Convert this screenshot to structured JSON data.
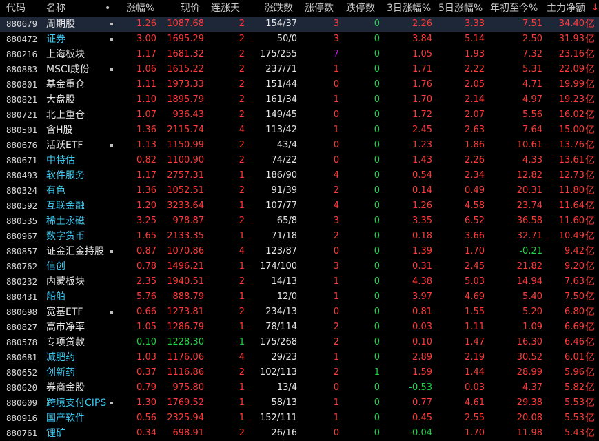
{
  "colors": {
    "up": "#ff3a3a",
    "down": "#22d24a",
    "neutral": "#e6e6e6",
    "highlight_name": "#3cc8f0",
    "limit_up_special": "#c020e0",
    "selected_row": "#1e2738",
    "background": "#000000"
  },
  "icons": {
    "sort": "sort-descending-arrow-icon",
    "marker": "dot-marker-icon"
  },
  "header": {
    "code": "代码",
    "name": "名称",
    "marker": "•",
    "change_pct": "涨幅%",
    "price": "现价",
    "streak": "连涨天",
    "up_down": "涨跌数",
    "limit_up": "涨停数",
    "limit_down": "跌停数",
    "d3_pct": "3日涨幅%",
    "d5_pct": "5日涨幅%",
    "ytd_pct": "年初至今%",
    "main_net": "主力净额",
    "sort_arrow": "↓"
  },
  "unit": "亿",
  "rows": [
    {
      "code": "880679",
      "name": "周期股",
      "name_color": "white",
      "dot": true,
      "chg": "1.26",
      "price": "1087.68",
      "streak": "2",
      "updown": "154/37",
      "lu": "3",
      "lu_color": "red",
      "ld": "0",
      "d3": "2.26",
      "d5": "3.33",
      "ytd": "7.51",
      "ytd_color": "red",
      "net": "34.40",
      "selected": true
    },
    {
      "code": "880472",
      "name": "证券",
      "name_color": "cyan",
      "dot": true,
      "chg": "3.00",
      "price": "1695.29",
      "streak": "2",
      "updown": "50/0",
      "lu": "3",
      "lu_color": "red",
      "ld": "0",
      "d3": "3.84",
      "d5": "5.14",
      "ytd": "2.50",
      "ytd_color": "red",
      "net": "31.93"
    },
    {
      "code": "880216",
      "name": "上海板块",
      "name_color": "white",
      "dot": false,
      "chg": "1.17",
      "price": "1681.32",
      "streak": "2",
      "updown": "175/255",
      "lu": "7",
      "lu_color": "purple",
      "ld": "0",
      "d3": "1.05",
      "d5": "1.93",
      "ytd": "7.32",
      "ytd_color": "red",
      "net": "23.16"
    },
    {
      "code": "880883",
      "name": "MSCI成份",
      "name_color": "white",
      "dot": true,
      "chg": "1.06",
      "price": "1615.22",
      "streak": "2",
      "updown": "237/71",
      "lu": "1",
      "lu_color": "red",
      "ld": "0",
      "d3": "1.71",
      "d5": "2.22",
      "ytd": "5.31",
      "ytd_color": "red",
      "net": "22.09"
    },
    {
      "code": "880801",
      "name": "基金重仓",
      "name_color": "white",
      "dot": false,
      "chg": "1.11",
      "price": "1973.33",
      "streak": "2",
      "updown": "151/44",
      "lu": "0",
      "lu_color": "red",
      "ld": "0",
      "d3": "1.76",
      "d5": "2.05",
      "ytd": "4.71",
      "ytd_color": "red",
      "net": "19.99"
    },
    {
      "code": "880821",
      "name": "大盘股",
      "name_color": "white",
      "dot": false,
      "chg": "1.10",
      "price": "1895.79",
      "streak": "2",
      "updown": "161/34",
      "lu": "1",
      "lu_color": "red",
      "ld": "0",
      "d3": "1.70",
      "d5": "2.14",
      "ytd": "4.97",
      "ytd_color": "red",
      "net": "19.23"
    },
    {
      "code": "880721",
      "name": "北上重仓",
      "name_color": "white",
      "dot": false,
      "chg": "1.07",
      "price": "936.43",
      "streak": "2",
      "updown": "149/45",
      "lu": "0",
      "lu_color": "red",
      "ld": "0",
      "d3": "1.72",
      "d5": "2.07",
      "ytd": "5.56",
      "ytd_color": "red",
      "net": "16.02"
    },
    {
      "code": "880501",
      "name": "含H股",
      "name_color": "white",
      "dot": false,
      "chg": "1.36",
      "price": "2115.74",
      "streak": "4",
      "updown": "113/42",
      "lu": "1",
      "lu_color": "red",
      "ld": "0",
      "d3": "2.45",
      "d5": "2.63",
      "ytd": "7.64",
      "ytd_color": "red",
      "net": "15.00"
    },
    {
      "code": "880676",
      "name": "活跃ETF",
      "name_color": "white",
      "dot": true,
      "chg": "1.13",
      "price": "1150.99",
      "streak": "2",
      "updown": "43/4",
      "lu": "0",
      "lu_color": "red",
      "ld": "0",
      "d3": "1.23",
      "d5": "1.86",
      "ytd": "10.61",
      "ytd_color": "red",
      "net": "13.76"
    },
    {
      "code": "880671",
      "name": "中特估",
      "name_color": "cyan",
      "dot": false,
      "chg": "0.82",
      "price": "1100.90",
      "streak": "2",
      "updown": "74/22",
      "lu": "0",
      "lu_color": "red",
      "ld": "0",
      "d3": "1.43",
      "d5": "2.26",
      "ytd": "4.33",
      "ytd_color": "red",
      "net": "13.61"
    },
    {
      "code": "880493",
      "name": "软件服务",
      "name_color": "cyan",
      "dot": false,
      "chg": "1.17",
      "price": "2757.31",
      "streak": "1",
      "updown": "186/90",
      "lu": "4",
      "lu_color": "red",
      "ld": "0",
      "d3": "0.54",
      "d5": "2.34",
      "ytd": "12.82",
      "ytd_color": "red",
      "net": "12.73"
    },
    {
      "code": "880324",
      "name": "有色",
      "name_color": "cyan",
      "dot": false,
      "chg": "1.36",
      "price": "1052.51",
      "streak": "2",
      "updown": "91/39",
      "lu": "2",
      "lu_color": "red",
      "ld": "0",
      "d3": "0.14",
      "d5": "0.49",
      "ytd": "20.31",
      "ytd_color": "red",
      "net": "11.80"
    },
    {
      "code": "880592",
      "name": "互联金融",
      "name_color": "cyan",
      "dot": false,
      "chg": "1.20",
      "price": "3233.64",
      "streak": "1",
      "updown": "107/77",
      "lu": "4",
      "lu_color": "red",
      "ld": "0",
      "d3": "1.26",
      "d5": "4.58",
      "ytd": "23.74",
      "ytd_color": "red",
      "net": "11.64"
    },
    {
      "code": "880535",
      "name": "稀土永磁",
      "name_color": "cyan",
      "dot": false,
      "chg": "3.25",
      "price": "978.87",
      "streak": "2",
      "updown": "65/8",
      "lu": "3",
      "lu_color": "red",
      "ld": "0",
      "d3": "3.35",
      "d5": "6.52",
      "ytd": "36.58",
      "ytd_color": "red",
      "net": "11.60"
    },
    {
      "code": "880967",
      "name": "数字货币",
      "name_color": "cyan",
      "dot": false,
      "chg": "1.65",
      "price": "2133.35",
      "streak": "1",
      "updown": "71/18",
      "lu": "2",
      "lu_color": "red",
      "ld": "0",
      "d3": "0.18",
      "d5": "3.66",
      "ytd": "32.71",
      "ytd_color": "red",
      "net": "10.49"
    },
    {
      "code": "880857",
      "name": "证金汇金持股",
      "name_color": "white",
      "dot": true,
      "chg": "0.87",
      "price": "1070.86",
      "streak": "4",
      "updown": "123/87",
      "lu": "0",
      "lu_color": "red",
      "ld": "0",
      "d3": "1.39",
      "d5": "1.70",
      "ytd": "-0.21",
      "ytd_color": "green",
      "net": "9.42"
    },
    {
      "code": "880762",
      "name": "信创",
      "name_color": "cyan",
      "dot": false,
      "chg": "0.78",
      "price": "1496.21",
      "streak": "1",
      "updown": "174/100",
      "lu": "3",
      "lu_color": "red",
      "ld": "0",
      "d3": "0.31",
      "d5": "2.45",
      "ytd": "21.82",
      "ytd_color": "red",
      "net": "9.20"
    },
    {
      "code": "880232",
      "name": "内蒙板块",
      "name_color": "white",
      "dot": false,
      "chg": "2.35",
      "price": "1940.51",
      "streak": "2",
      "updown": "14/13",
      "lu": "1",
      "lu_color": "red",
      "ld": "0",
      "d3": "4.38",
      "d5": "5.03",
      "ytd": "14.94",
      "ytd_color": "red",
      "net": "7.63"
    },
    {
      "code": "880431",
      "name": "船舶",
      "name_color": "cyan",
      "dot": false,
      "chg": "5.76",
      "price": "888.79",
      "streak": "1",
      "updown": "12/0",
      "lu": "1",
      "lu_color": "red",
      "ld": "0",
      "d3": "3.97",
      "d5": "4.69",
      "ytd": "5.40",
      "ytd_color": "red",
      "net": "7.50"
    },
    {
      "code": "880698",
      "name": "宽基ETF",
      "name_color": "white",
      "dot": true,
      "chg": "0.66",
      "price": "1273.81",
      "streak": "2",
      "updown": "234/13",
      "lu": "0",
      "lu_color": "red",
      "ld": "0",
      "d3": "0.81",
      "d5": "1.55",
      "ytd": "5.20",
      "ytd_color": "red",
      "net": "6.80"
    },
    {
      "code": "880827",
      "name": "高市净率",
      "name_color": "white",
      "dot": false,
      "chg": "1.05",
      "price": "1286.79",
      "streak": "1",
      "updown": "78/114",
      "lu": "2",
      "lu_color": "red",
      "ld": "0",
      "d3": "0.03",
      "d5": "1.11",
      "ytd": "1.09",
      "ytd_color": "red",
      "net": "6.69"
    },
    {
      "code": "880578",
      "name": "专项贷款",
      "name_color": "white",
      "dot": false,
      "chg": "-0.10",
      "price": "1228.30",
      "streak": "-1",
      "updown": "175/268",
      "lu": "2",
      "lu_color": "red",
      "ld": "0",
      "d3": "0.10",
      "d5": "1.47",
      "ytd": "16.30",
      "ytd_color": "red",
      "net": "6.46"
    },
    {
      "code": "880681",
      "name": "减肥药",
      "name_color": "cyan",
      "dot": false,
      "chg": "1.03",
      "price": "1176.06",
      "streak": "4",
      "updown": "29/23",
      "lu": "1",
      "lu_color": "red",
      "ld": "0",
      "d3": "2.89",
      "d5": "2.19",
      "ytd": "30.52",
      "ytd_color": "red",
      "net": "6.01"
    },
    {
      "code": "880652",
      "name": "创新药",
      "name_color": "cyan",
      "dot": false,
      "chg": "0.37",
      "price": "1116.86",
      "streak": "2",
      "updown": "102/113",
      "lu": "2",
      "lu_color": "red",
      "ld": "1",
      "d3": "1.59",
      "d5": "1.44",
      "ytd": "28.99",
      "ytd_color": "red",
      "net": "5.96"
    },
    {
      "code": "880620",
      "name": "券商金股",
      "name_color": "white",
      "dot": false,
      "chg": "0.79",
      "price": "975.80",
      "streak": "1",
      "updown": "13/4",
      "lu": "0",
      "lu_color": "red",
      "ld": "0",
      "d3": "-0.53",
      "d5": "0.03",
      "ytd": "4.37",
      "ytd_color": "red",
      "net": "5.82"
    },
    {
      "code": "880609",
      "name": "跨境支付CIPS",
      "name_color": "cyan",
      "dot": true,
      "chg": "1.30",
      "price": "1769.52",
      "streak": "1",
      "updown": "58/13",
      "lu": "1",
      "lu_color": "red",
      "ld": "0",
      "d3": "0.77",
      "d5": "4.61",
      "ytd": "29.38",
      "ytd_color": "red",
      "net": "5.53"
    },
    {
      "code": "880916",
      "name": "国产软件",
      "name_color": "cyan",
      "dot": false,
      "chg": "0.56",
      "price": "2325.94",
      "streak": "1",
      "updown": "152/111",
      "lu": "1",
      "lu_color": "red",
      "ld": "0",
      "d3": "0.45",
      "d5": "2.55",
      "ytd": "20.08",
      "ytd_color": "red",
      "net": "5.53"
    },
    {
      "code": "880761",
      "name": "锂矿",
      "name_color": "cyan",
      "dot": false,
      "chg": "0.34",
      "price": "698.91",
      "streak": "2",
      "updown": "26/16",
      "lu": "0",
      "lu_color": "red",
      "ld": "0",
      "d3": "-0.04",
      "d5": "1.70",
      "ytd": "11.98",
      "ytd_color": "red",
      "net": "5.43"
    }
  ]
}
